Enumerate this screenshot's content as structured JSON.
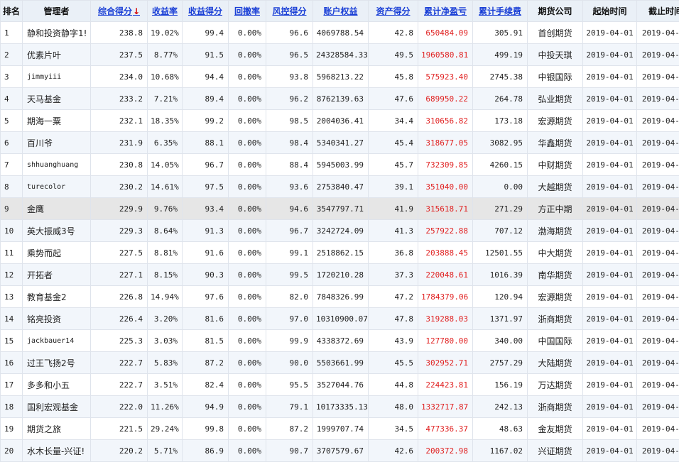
{
  "headers": [
    {
      "key": "rank",
      "label": "排名",
      "link": false
    },
    {
      "key": "manager",
      "label": "管理者",
      "link": false
    },
    {
      "key": "composite",
      "label": "综合得分",
      "link": true,
      "sorted": true,
      "sort_arrow": "↓"
    },
    {
      "key": "return_rate",
      "label": "收益率",
      "link": true
    },
    {
      "key": "return_score",
      "label": "收益得分",
      "link": true
    },
    {
      "key": "drawdown",
      "label": "回撤率",
      "link": true
    },
    {
      "key": "risk_score",
      "label": "风控得分",
      "link": true
    },
    {
      "key": "equity",
      "label": "账户权益",
      "link": true
    },
    {
      "key": "asset_score",
      "label": "资产得分",
      "link": true
    },
    {
      "key": "net_pnl",
      "label": "累计净盈亏",
      "link": true
    },
    {
      "key": "fees",
      "label": "累计手续费",
      "link": true
    },
    {
      "key": "broker",
      "label": "期货公司",
      "link": false
    },
    {
      "key": "start",
      "label": "起始时间",
      "link": false
    },
    {
      "key": "end",
      "label": "截止时间",
      "link": false
    }
  ],
  "rows": [
    {
      "rank": "1",
      "manager": "静和投资静字1!",
      "composite": "238.8",
      "return_rate": "19.02%",
      "return_score": "99.4",
      "drawdown": "0.00%",
      "risk_score": "96.6",
      "equity": "4069788.54",
      "asset_score": "42.8",
      "net_pnl": "650484.09",
      "fees": "305.91",
      "broker": "首创期货",
      "start": "2019-04-01",
      "end": "2019-04-02"
    },
    {
      "rank": "2",
      "manager": "优素片叶",
      "composite": "237.5",
      "return_rate": "8.77%",
      "return_score": "91.5",
      "drawdown": "0.00%",
      "risk_score": "96.5",
      "equity": "24328584.33",
      "asset_score": "49.5",
      "net_pnl": "1960580.81",
      "fees": "499.19",
      "broker": "中投天琪",
      "start": "2019-04-01",
      "end": "2019-04-01"
    },
    {
      "rank": "3",
      "manager": "jimmyiii",
      "composite": "234.0",
      "return_rate": "10.68%",
      "return_score": "94.4",
      "drawdown": "0.00%",
      "risk_score": "93.8",
      "equity": "5968213.22",
      "asset_score": "45.8",
      "net_pnl": "575923.40",
      "fees": "2745.38",
      "broker": "中银国际",
      "start": "2019-04-01",
      "end": "2019-04-02"
    },
    {
      "rank": "4",
      "manager": "天马基金",
      "composite": "233.2",
      "return_rate": "7.21%",
      "return_score": "89.4",
      "drawdown": "0.00%",
      "risk_score": "96.2",
      "equity": "8762139.63",
      "asset_score": "47.6",
      "net_pnl": "689950.22",
      "fees": "264.78",
      "broker": "弘业期货",
      "start": "2019-04-01",
      "end": "2019-04-01"
    },
    {
      "rank": "5",
      "manager": "期海一粟",
      "composite": "232.1",
      "return_rate": "18.35%",
      "return_score": "99.2",
      "drawdown": "0.00%",
      "risk_score": "98.5",
      "equity": "2004036.41",
      "asset_score": "34.4",
      "net_pnl": "310656.82",
      "fees": "173.18",
      "broker": "宏源期货",
      "start": "2019-04-01",
      "end": "2019-04-02"
    },
    {
      "rank": "6",
      "manager": "百川爷",
      "composite": "231.9",
      "return_rate": "6.35%",
      "return_score": "88.1",
      "drawdown": "0.00%",
      "risk_score": "98.4",
      "equity": "5340341.27",
      "asset_score": "45.4",
      "net_pnl": "318677.05",
      "fees": "3082.95",
      "broker": "华鑫期货",
      "start": "2019-04-01",
      "end": "2019-04-02"
    },
    {
      "rank": "7",
      "manager": "shhuanghuang",
      "composite": "230.8",
      "return_rate": "14.05%",
      "return_score": "96.7",
      "drawdown": "0.00%",
      "risk_score": "88.4",
      "equity": "5945003.99",
      "asset_score": "45.7",
      "net_pnl": "732309.85",
      "fees": "4260.15",
      "broker": "中财期货",
      "start": "2019-04-01",
      "end": "2019-04-02"
    },
    {
      "rank": "8",
      "manager": "turecolor",
      "composite": "230.2",
      "return_rate": "14.61%",
      "return_score": "97.5",
      "drawdown": "0.00%",
      "risk_score": "93.6",
      "equity": "2753840.47",
      "asset_score": "39.1",
      "net_pnl": "351040.00",
      "fees": "0.00",
      "broker": "大越期货",
      "start": "2019-04-01",
      "end": "2019-04-02"
    },
    {
      "rank": "9",
      "manager": "金鹰",
      "composite": "229.9",
      "return_rate": "9.76%",
      "return_score": "93.4",
      "drawdown": "0.00%",
      "risk_score": "94.6",
      "equity": "3547797.71",
      "asset_score": "41.9",
      "net_pnl": "315618.71",
      "fees": "271.29",
      "broker": "方正中期",
      "start": "2019-04-01",
      "end": "2019-04-01"
    },
    {
      "rank": "10",
      "manager": "英大振威3号",
      "composite": "229.3",
      "return_rate": "8.64%",
      "return_score": "91.3",
      "drawdown": "0.00%",
      "risk_score": "96.7",
      "equity": "3242724.09",
      "asset_score": "41.3",
      "net_pnl": "257922.88",
      "fees": "707.12",
      "broker": "渤海期货",
      "start": "2019-04-01",
      "end": "2019-04-02"
    },
    {
      "rank": "11",
      "manager": "乘势而起",
      "composite": "227.5",
      "return_rate": "8.81%",
      "return_score": "91.6",
      "drawdown": "0.00%",
      "risk_score": "99.1",
      "equity": "2518862.15",
      "asset_score": "36.8",
      "net_pnl": "203888.45",
      "fees": "12501.55",
      "broker": "中大期货",
      "start": "2019-04-01",
      "end": "2019-04-02"
    },
    {
      "rank": "12",
      "manager": "开拓者",
      "composite": "227.1",
      "return_rate": "8.15%",
      "return_score": "90.3",
      "drawdown": "0.00%",
      "risk_score": "99.5",
      "equity": "1720210.28",
      "asset_score": "37.3",
      "net_pnl": "220048.61",
      "fees": "1016.39",
      "broker": "南华期货",
      "start": "2019-04-01",
      "end": "2019-04-02"
    },
    {
      "rank": "13",
      "manager": "教育基金2",
      "composite": "226.8",
      "return_rate": "14.94%",
      "return_score": "97.6",
      "drawdown": "0.00%",
      "risk_score": "82.0",
      "equity": "7848326.99",
      "asset_score": "47.2",
      "net_pnl": "1784379.06",
      "fees": "120.94",
      "broker": "宏源期货",
      "start": "2019-04-01",
      "end": "2019-04-02"
    },
    {
      "rank": "14",
      "manager": "铭亮投资",
      "composite": "226.4",
      "return_rate": "3.20%",
      "return_score": "81.6",
      "drawdown": "0.00%",
      "risk_score": "97.0",
      "equity": "10310900.07",
      "asset_score": "47.8",
      "net_pnl": "319288.03",
      "fees": "1371.97",
      "broker": "浙商期货",
      "start": "2019-04-01",
      "end": "2019-04-02"
    },
    {
      "rank": "15",
      "manager": "jackbauer14",
      "composite": "225.3",
      "return_rate": "3.03%",
      "return_score": "81.5",
      "drawdown": "0.00%",
      "risk_score": "99.9",
      "equity": "4338372.69",
      "asset_score": "43.9",
      "net_pnl": "127780.00",
      "fees": "340.00",
      "broker": "中国国际",
      "start": "2019-04-01",
      "end": "2019-04-02"
    },
    {
      "rank": "16",
      "manager": "过王飞扬2号",
      "composite": "222.7",
      "return_rate": "5.83%",
      "return_score": "87.2",
      "drawdown": "0.00%",
      "risk_score": "90.0",
      "equity": "5503661.99",
      "asset_score": "45.5",
      "net_pnl": "302952.71",
      "fees": "2757.29",
      "broker": "大陆期货",
      "start": "2019-04-01",
      "end": "2019-04-01"
    },
    {
      "rank": "17",
      "manager": "多多和小五",
      "composite": "222.7",
      "return_rate": "3.51%",
      "return_score": "82.4",
      "drawdown": "0.00%",
      "risk_score": "95.5",
      "equity": "3527044.76",
      "asset_score": "44.8",
      "net_pnl": "224423.81",
      "fees": "156.19",
      "broker": "万达期货",
      "start": "2019-04-01",
      "end": "2019-04-01"
    },
    {
      "rank": "18",
      "manager": "国利宏观基金",
      "composite": "222.0",
      "return_rate": "11.26%",
      "return_score": "94.9",
      "drawdown": "0.00%",
      "risk_score": "79.1",
      "equity": "10173335.13",
      "asset_score": "48.0",
      "net_pnl": "1332717.87",
      "fees": "242.13",
      "broker": "浙商期货",
      "start": "2019-04-01",
      "end": "2019-04-02"
    },
    {
      "rank": "19",
      "manager": "期货之旅",
      "composite": "221.5",
      "return_rate": "29.24%",
      "return_score": "99.8",
      "drawdown": "0.00%",
      "risk_score": "87.2",
      "equity": "1999707.74",
      "asset_score": "34.5",
      "net_pnl": "477336.37",
      "fees": "48.63",
      "broker": "金友期货",
      "start": "2019-04-01",
      "end": "2019-04-02"
    },
    {
      "rank": "20",
      "manager": "水木长量-兴证!",
      "composite": "220.2",
      "return_rate": "5.71%",
      "return_score": "86.9",
      "drawdown": "0.00%",
      "risk_score": "90.7",
      "equity": "3707579.67",
      "asset_score": "42.6",
      "net_pnl": "200372.98",
      "fees": "1167.02",
      "broker": "兴证期货",
      "start": "2019-04-01",
      "end": "2019-04-02"
    }
  ],
  "highlight_row": "9",
  "colors": {
    "link": "#1a3fd6",
    "negative_or_pnl": "#e02020",
    "header_bg": "#eaf0f7",
    "stripe_bg": "#f2f6fb",
    "highlight_bg": "#e6e6e6"
  }
}
